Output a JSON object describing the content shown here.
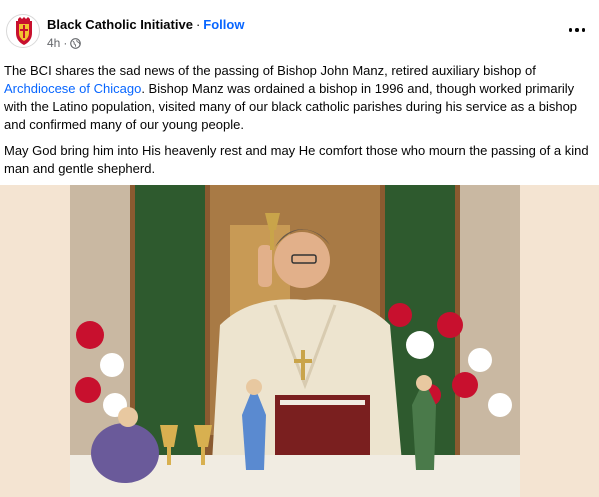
{
  "post": {
    "author": "Black Catholic Initiative",
    "separator": "·",
    "follow_label": "Follow",
    "time": "4h",
    "visibility_icon": "globe-icon",
    "more_icon": "more-options-icon",
    "paragraph1_before_link": "The BCI shares the sad news of the passing of Bishop John Manz, retired auxiliary bishop of ",
    "link_text": "Archdiocese of Chicago",
    "paragraph1_after_link": ". Bishop Manz was ordained a bishop in 1996 and, though worked primarily with the Latino population, visited many of our black catholic parishes during his service as a bishop and confirmed many of our young people.",
    "paragraph2": "May God bring him into His heavenly rest and may He comfort those who mourn the passing of a kind man and gentle shepherd."
  },
  "colors": {
    "link": "#0866ff",
    "meta": "#65676b",
    "photo_background": "#f4e4d2"
  }
}
